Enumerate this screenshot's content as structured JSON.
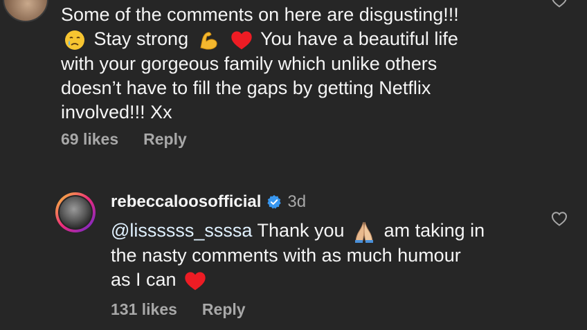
{
  "comment_top": {
    "lines": [
      "Some of the comments on here are disgusting!!!",
      "Stay strong",
      "You have a beautiful life",
      "with your gorgeous family which unlike others",
      "doesn’t have to fill the gaps by getting Netflix",
      "involved!!! Xx"
    ],
    "likes": "69 likes",
    "reply_label": "Reply"
  },
  "comment_reply": {
    "username": "rebeccaloosofficial",
    "verified": true,
    "timestamp": "3d",
    "mention": "@lissssss_ssssa",
    "text_line1": "Thank you",
    "text_line1_after": "am taking in",
    "text_line2": "the nasty comments with as much humour",
    "text_line3": "as I can",
    "likes": "131 likes",
    "reply_label": "Reply"
  },
  "icons": {
    "heart_outline": "heart-outline-icon",
    "verified_badge": "verified-badge-icon",
    "emoji_crying": "crying-face-emoji",
    "emoji_muscle": "flexed-biceps-emoji",
    "emoji_heart": "red-heart-emoji",
    "emoji_pray": "folded-hands-emoji"
  },
  "colors": {
    "background": "#262626",
    "text": "#f5f5f5",
    "secondary": "#a8a8a8",
    "verified": "#3897f0",
    "heart": "#ed1c24"
  }
}
